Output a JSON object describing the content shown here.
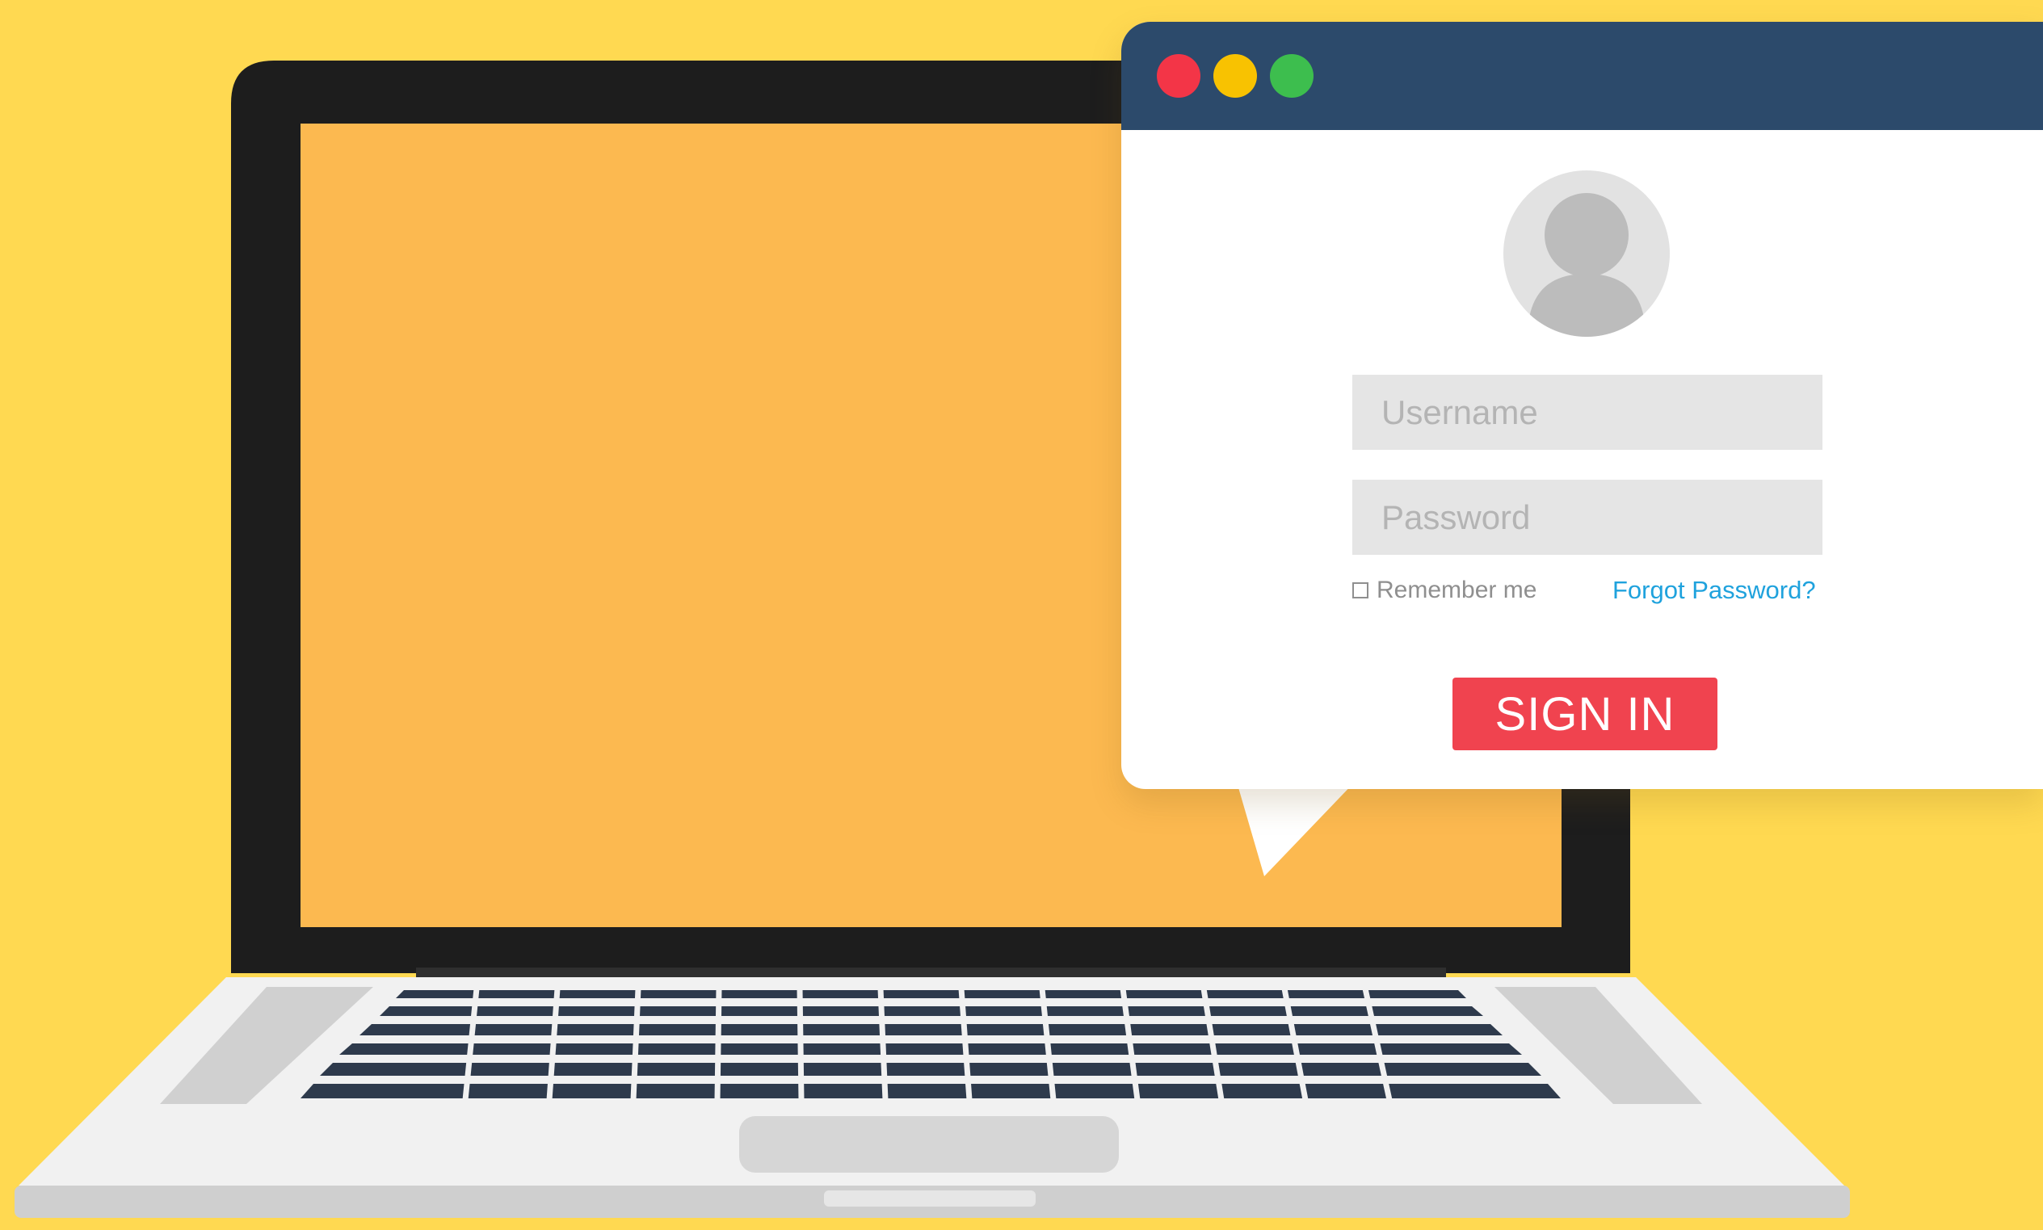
{
  "login": {
    "username_placeholder": "Username",
    "password_placeholder": "Password",
    "remember_label": "Remember me",
    "forgot_label": "Forgot Password?",
    "signin_label": "SIGN IN"
  },
  "colors": {
    "background": "#ffd951",
    "laptop_screen": "#fcb950",
    "laptop_bezel": "#1d1d1d",
    "titlebar": "#2c4a6b",
    "close_dot": "#f33547",
    "minimize_dot": "#f8c201",
    "maximize_dot": "#3dbe4e",
    "signin_button": "#f0434f",
    "forgot_link": "#1fa2dd"
  },
  "icons": {
    "avatar": "user-silhouette-icon",
    "window_controls": [
      "close-dot",
      "minimize-dot",
      "maximize-dot"
    ]
  }
}
